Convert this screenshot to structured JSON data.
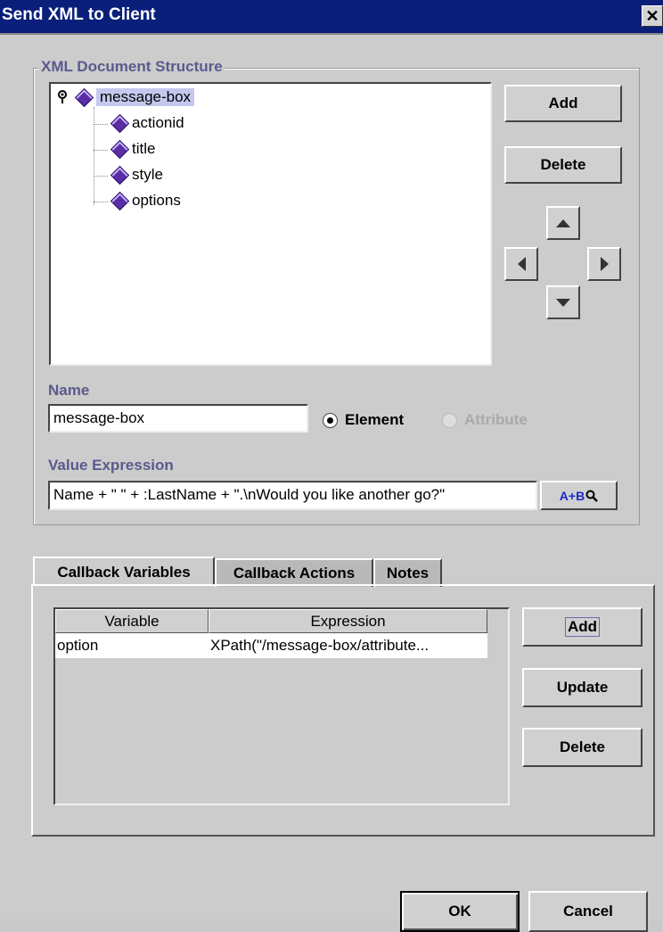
{
  "window": {
    "title": "Send XML to Client",
    "close_glyph": "✕"
  },
  "structure_group": {
    "label": "XML Document Structure"
  },
  "tree": {
    "root": {
      "label": "message-box"
    },
    "children": [
      {
        "label": "actionid"
      },
      {
        "label": "title"
      },
      {
        "label": "style"
      },
      {
        "label": "options"
      }
    ]
  },
  "structure_buttons": {
    "add": "Add",
    "delete": "Delete"
  },
  "name": {
    "label": "Name",
    "value": "message-box"
  },
  "node_type": {
    "element": "Element",
    "attribute": "Attribute",
    "selected": "Element"
  },
  "value_expression": {
    "label": "Value Expression",
    "value": "Name + \" \" + :LastName + \".\\nWould you like another go?\"",
    "builder_label": "A+B"
  },
  "tabs": [
    {
      "label": "Callback Variables",
      "active": true
    },
    {
      "label": "Callback Actions",
      "active": false
    },
    {
      "label": "Notes",
      "active": false
    }
  ],
  "callback_table": {
    "columns": [
      "Variable",
      "Expression"
    ],
    "rows": [
      {
        "variable": "option",
        "expression": "XPath(\"/message-box/attribute..."
      }
    ]
  },
  "callback_buttons": {
    "add": "Add",
    "update": "Update",
    "delete": "Delete"
  },
  "footer": {
    "ok": "OK",
    "cancel": "Cancel"
  }
}
